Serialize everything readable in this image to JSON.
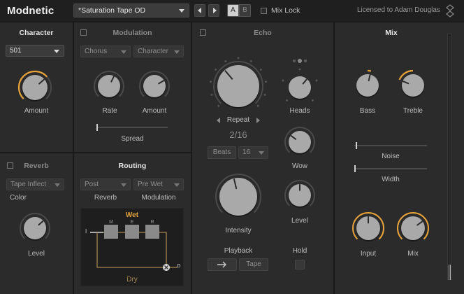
{
  "header": {
    "app_title": "Modnetic",
    "preset_name": "*Saturation Tape OD",
    "ab_a": "A",
    "ab_b": "B",
    "mix_lock_label": "Mix Lock",
    "license_text": "Licensed to Adam Douglas"
  },
  "character": {
    "title": "Character",
    "model_value": "501",
    "amount_label": "Amount",
    "amount_level": 0.68
  },
  "modulation": {
    "title": "Modulation",
    "type_value": "Chorus",
    "target_value": "Character",
    "rate_label": "Rate",
    "amount_label": "Amount",
    "spread_label": "Spread",
    "rate_level": 0.6,
    "amount_level": 0.72,
    "spread_level": 0.0
  },
  "reverb": {
    "title": "Reverb",
    "type_value": "Tape Inflect",
    "color_label": "Color",
    "level_label": "Level",
    "level_level": 0.68
  },
  "routing": {
    "title": "Routing",
    "reverb_position_value": "Post",
    "reverb_label": "Reverb",
    "modulation_position_value": "Pre Wet",
    "modulation_label": "Modulation",
    "wet_label": "Wet",
    "dry_label": "Dry",
    "in_label": "I",
    "out_label": "O",
    "slots": [
      "M",
      "E",
      "R"
    ]
  },
  "echo": {
    "title": "Echo",
    "repeat_label": "Repeat",
    "repeat_value": "2/16",
    "sync_mode_value": "Beats",
    "division_value": "16",
    "heads_label": "Heads",
    "wow_label": "Wow",
    "intensity_label": "Intensity",
    "level_label": "Level",
    "playback_label": "Playback",
    "playback_direction_icon": "arrow-right-icon",
    "playback_mode_value": "Tape",
    "hold_label": "Hold",
    "repeat_level": 0.35,
    "heads_level": 0.65,
    "wow_level": 0.3,
    "intensity_level": 0.45,
    "level_level": 0.5
  },
  "mix": {
    "title": "Mix",
    "bass_label": "Bass",
    "treble_label": "Treble",
    "noise_label": "Noise",
    "width_label": "Width",
    "input_label": "Input",
    "mix_label": "Mix",
    "bass_level": 0.55,
    "treble_level": 0.25,
    "noise_level": 0.02,
    "width_level": 0.0,
    "input_level": 0.5,
    "mix_level": 0.7
  },
  "colors": {
    "accent": "#e8a33a",
    "knob_face": "#a9a9a9",
    "panel": "#2b2b2b",
    "header": "#1f1f1f"
  }
}
